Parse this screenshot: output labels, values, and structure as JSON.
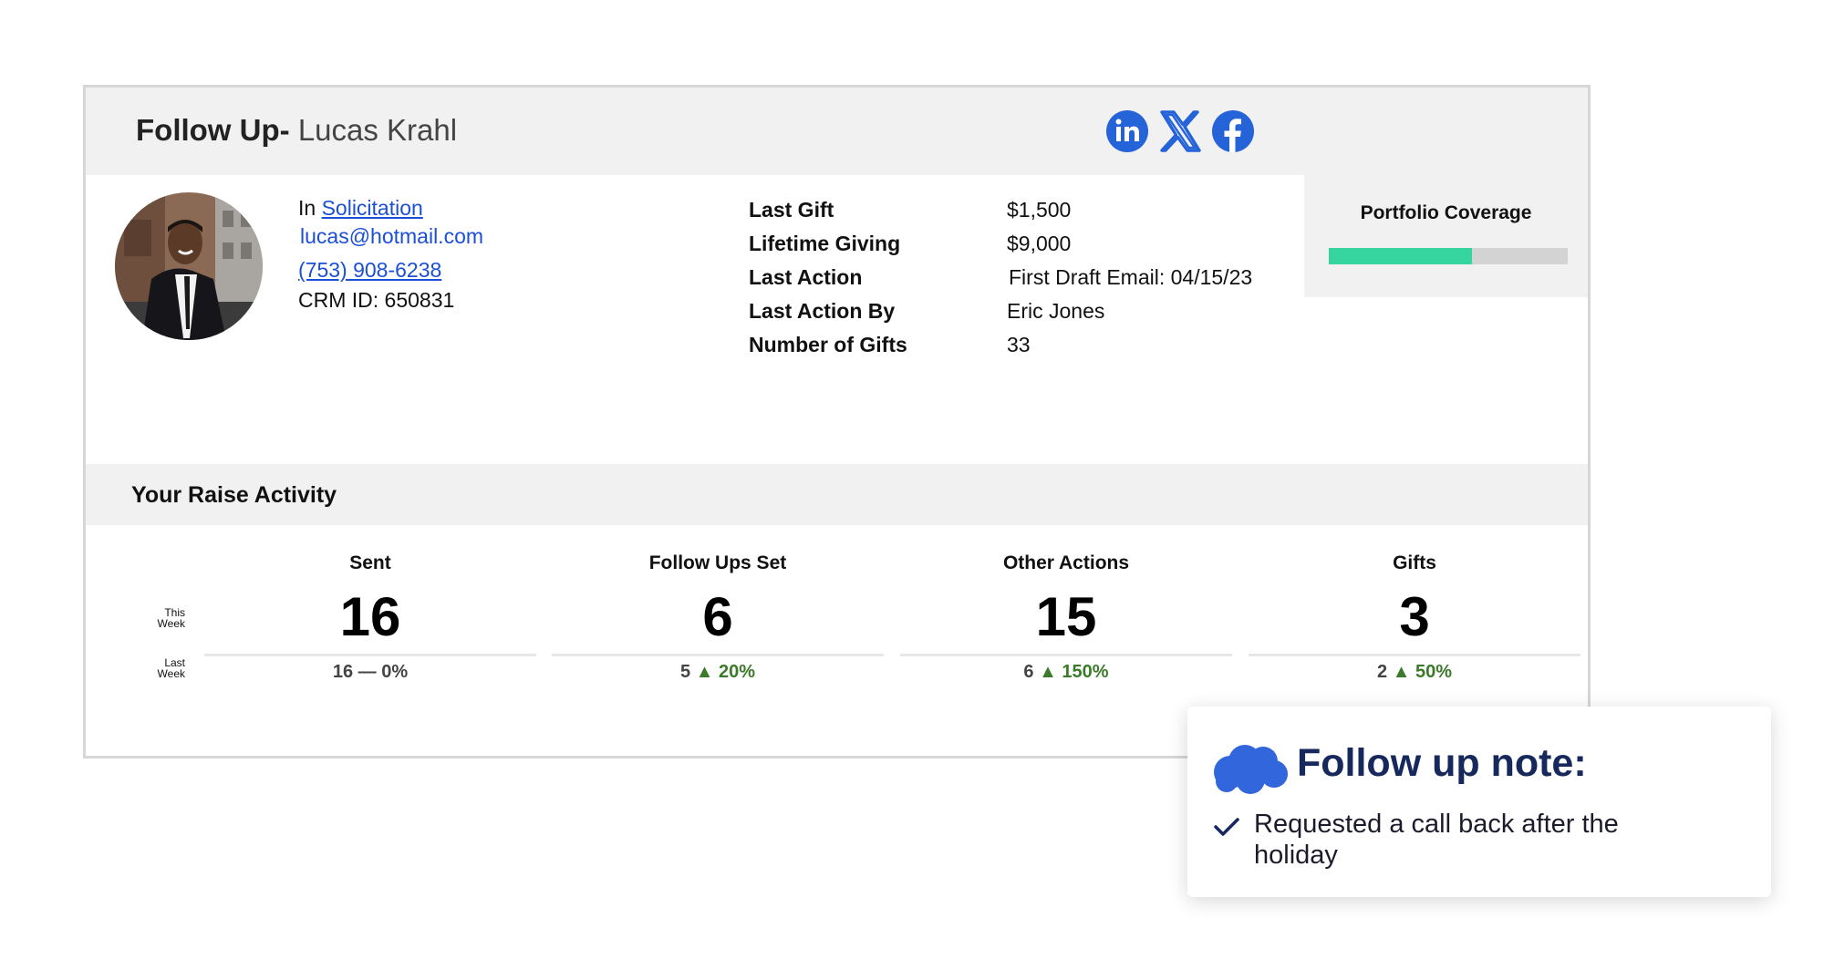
{
  "header": {
    "title_prefix": "Follow Up-",
    "name": "Lucas Krahl",
    "social": [
      "linkedin-icon",
      "x-icon",
      "facebook-icon"
    ]
  },
  "coverage": {
    "label": "Portfolio Coverage",
    "fraction": 0.6
  },
  "contact": {
    "stage_prefix": "In",
    "stage": "Solicitation",
    "email": "lucas@hotmail.com",
    "phone": "(753) 908-6238",
    "crm": "CRM ID: 650831"
  },
  "details": [
    {
      "label": "Last Gift",
      "value": "$1,500"
    },
    {
      "label": "Lifetime Giving",
      "value": "$9,000"
    },
    {
      "label": "Last Action",
      "value": "First Draft Email: 04/15/23"
    },
    {
      "label": "Last Action By",
      "value": "Eric Jones"
    },
    {
      "label": "Number of Gifts",
      "value": "33"
    }
  ],
  "raise": {
    "title": "Your Raise Activity",
    "this_week_label": [
      "This",
      "Week"
    ],
    "last_week_label": [
      "Last",
      "Week"
    ],
    "stats": [
      {
        "label": "Sent",
        "value": "16",
        "last": "16",
        "change": "— 0%"
      },
      {
        "label": "Follow Ups Set",
        "value": "6",
        "last": "5",
        "change": "▲ 20%"
      },
      {
        "label": "Other Actions",
        "value": "15",
        "last": "6",
        "change": "▲ 150%"
      },
      {
        "label": "Gifts",
        "value": "3",
        "last": "2",
        "change": "▲ 50%"
      }
    ]
  },
  "note": {
    "title": "Follow up note:",
    "item": "Requested a call back after the holiday",
    "icons": [
      "salesforce-cloud-icon",
      "checkmark-icon"
    ]
  },
  "colors": {
    "accent_link": "#1a4fd6",
    "coverage_bar": "#36d49f",
    "increase_green": "#3b7a2a",
    "note_title": "#16285c",
    "social_blue": "#2563d9"
  }
}
